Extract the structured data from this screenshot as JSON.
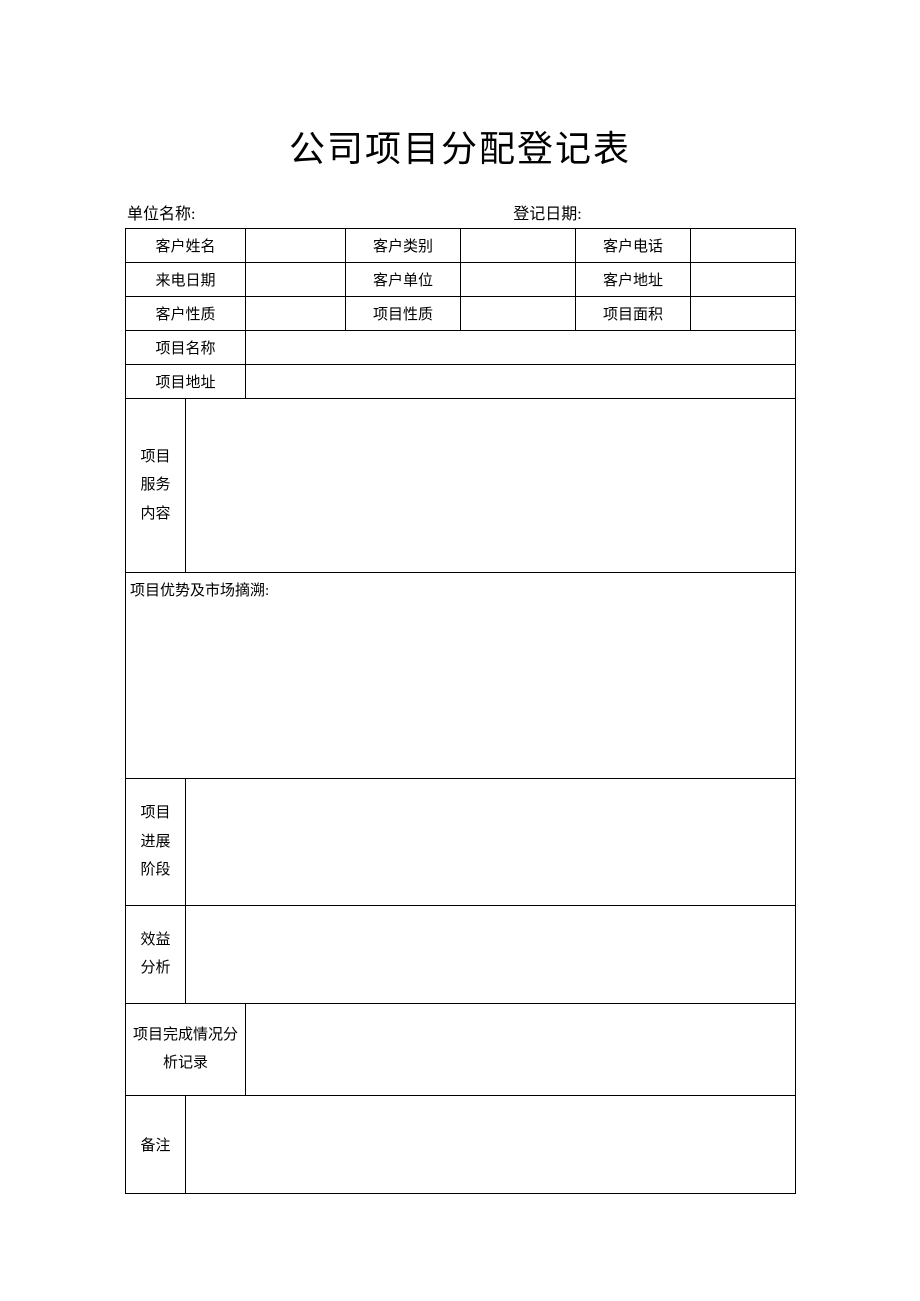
{
  "title": "公司项目分配登记表",
  "header": {
    "unit_label": "单位名称:",
    "date_label": "登记日期:"
  },
  "rows": {
    "r1": {
      "c1": "客户姓名",
      "c3": "客户类别",
      "c5": "客户电话"
    },
    "r2": {
      "c1": "来电日期",
      "c3": "客户单位",
      "c5": "客户地址"
    },
    "r3": {
      "c1": "客户性质",
      "c3": "项目性质",
      "c5": "项目面积"
    },
    "r4": {
      "c1": "项目名称"
    },
    "r5": {
      "c1": "项目地址"
    },
    "r6": {
      "c1": "项目\n服务\n内容"
    },
    "r7": {
      "c1": "项目优势及市场摘溯:"
    },
    "r8": {
      "c1": "项目\n进展\n阶段"
    },
    "r9": {
      "c1": "效益\n分析"
    },
    "r10": {
      "c1": "项目完成情况分\n析记录"
    },
    "r11": {
      "c1": "备注"
    }
  }
}
